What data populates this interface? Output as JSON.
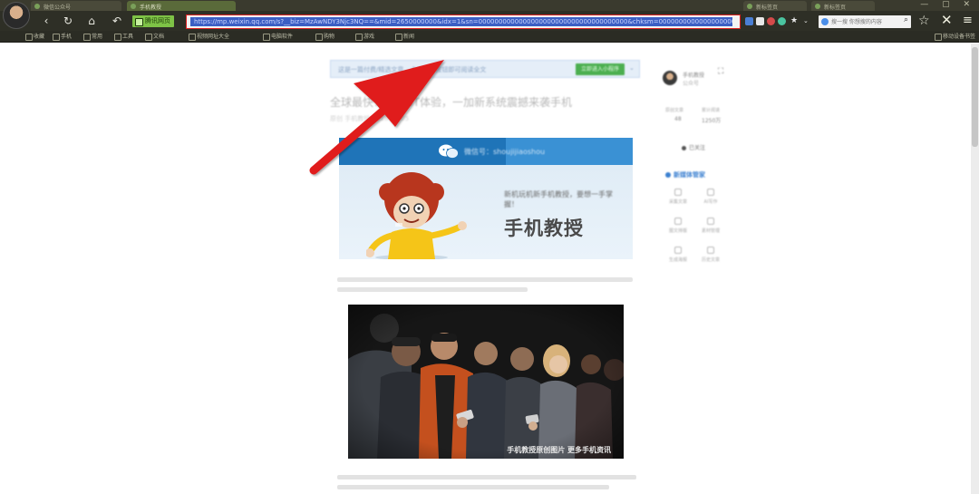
{
  "browser": {
    "tabs": [
      {
        "label": "微信公众号",
        "active": false
      },
      {
        "label": "手机教授",
        "active": true
      },
      {
        "label": "新标签页",
        "active": false
      },
      {
        "label": "新标签页",
        "active": false
      }
    ],
    "window_controls": "— ▢ ✕",
    "secure_badge": "腾讯网页",
    "url": "https://mp.weixin.qq.com/s?__biz=MzAwNDY3Njc3NQ==&mid=2650000000&idx=1&sn=0000000000000000000000000000000000000&chksm=0000000000000000000000000000000000#rd",
    "search_placeholder": "搜一搜 你想搜的内容",
    "bookmarks": [
      "收藏",
      "手机",
      "常用",
      "工具",
      "文档",
      "视频网址大全",
      "电脑软件",
      "购物",
      "游戏",
      "新闻"
    ],
    "bookmark_right": "移动设备书签"
  },
  "colors": {
    "url_highlight": "#3b5ec4",
    "url_border": "#dd2222",
    "secure_green": "#7ec246",
    "arrow_red": "#e01b1b",
    "accent_blue": "#3a7fd0",
    "hero_blue": "#1f74b8"
  },
  "article": {
    "banner_text": "这是一篇付费/精选文章，点击下方按钮即可阅读全文",
    "banner_button": "立即进入小程序",
    "title": "全球最快！一加6T体验，一加新系统震撼来袭手机",
    "meta": "原创 手机教授 2018-11-05",
    "hero_header": "微信号：shoujijiaoshou",
    "hero_subtitle": "新机玩机新手机教授，要想一手掌握！",
    "hero_title": "手机教授",
    "photo_caption": "手机教授原创图片 更多手机资讯"
  },
  "sidebar": {
    "author_name": "手机教授",
    "author_sub": "公众号",
    "stats": [
      {
        "label": "原创文章",
        "value": "48"
      },
      {
        "label": "累计阅读",
        "value": "1250万"
      }
    ],
    "follow_label": "已关注",
    "section_title": "新媒体管家",
    "tools": [
      {
        "label": "采集文章",
        "icon": "collect-icon"
      },
      {
        "label": "AI写作",
        "icon": "pen-icon"
      },
      {
        "label": "图文排版",
        "icon": "layout-icon"
      },
      {
        "label": "素材管理",
        "icon": "folder-icon"
      },
      {
        "label": "生成海报",
        "icon": "poster-icon"
      },
      {
        "label": "历史文章",
        "icon": "history-icon"
      }
    ]
  }
}
